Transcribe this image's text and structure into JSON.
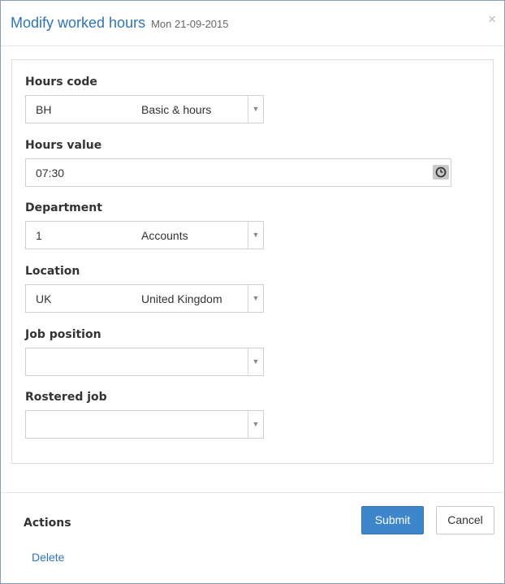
{
  "dialog": {
    "title": "Modify worked hours",
    "date": "Mon 21-09-2015",
    "close_glyph": "×"
  },
  "form": {
    "hours_code": {
      "label": "Hours code",
      "code": "BH",
      "description": "Basic & hours"
    },
    "hours_value": {
      "label": "Hours value",
      "value": "07:30",
      "icon": "clock-icon"
    },
    "department": {
      "label": "Department",
      "code": "1",
      "description": "Accounts"
    },
    "location": {
      "label": "Location",
      "code": "UK",
      "description": "United Kingdom"
    },
    "job_position": {
      "label": "Job position",
      "code": "",
      "description": ""
    },
    "rostered_job": {
      "label": "Rostered job",
      "code": "",
      "description": ""
    },
    "dropdown_glyph": "▼"
  },
  "footer": {
    "actions_label": "Actions",
    "delete_label": "Delete",
    "submit_label": "Submit",
    "cancel_label": "Cancel"
  },
  "colors": {
    "accent": "#2f74b5",
    "submit_bg": "#3d86cc",
    "border": "#cfcfcf"
  }
}
